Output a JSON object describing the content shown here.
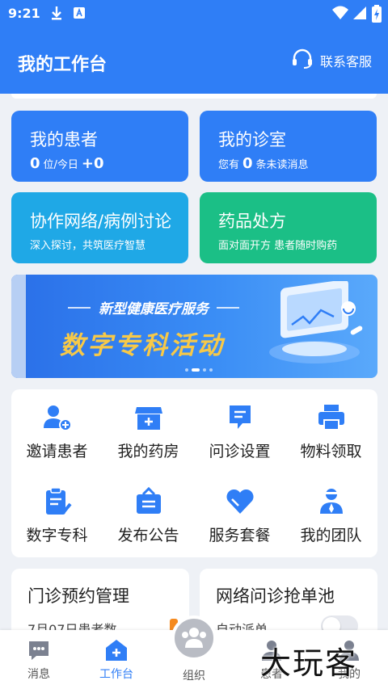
{
  "status": {
    "time": "9:21"
  },
  "header": {
    "title": "我的工作台",
    "service_label": "联系客服"
  },
  "cards": {
    "patients": {
      "title": "我的患者",
      "count": "0",
      "unit": "位/今日",
      "today": "+0"
    },
    "clinic": {
      "title": "我的诊室",
      "prefix": "您有",
      "count": "0",
      "suffix": "条未读消息"
    },
    "network": {
      "title": "协作网络/病例讨论",
      "sub": "深入探讨，共筑医疗智慧"
    },
    "drugs": {
      "title": "药品处方",
      "sub": "面对面开方 患者随时购药"
    }
  },
  "banner": {
    "subtitle": "新型健康医疗服务",
    "title": "数字专科活动"
  },
  "grid": [
    {
      "label": "邀请患者",
      "icon": "invite-patient-icon"
    },
    {
      "label": "我的药房",
      "icon": "pharmacy-icon"
    },
    {
      "label": "问诊设置",
      "icon": "consult-settings-icon"
    },
    {
      "label": "物料领取",
      "icon": "printer-icon"
    },
    {
      "label": "数字专科",
      "icon": "digital-specialty-icon"
    },
    {
      "label": "发布公告",
      "icon": "announcement-icon"
    },
    {
      "label": "服务套餐",
      "icon": "heart-icon"
    },
    {
      "label": "我的团队",
      "icon": "team-icon"
    }
  ],
  "bottom_cards": {
    "appointment": {
      "title": "门诊预约管理",
      "sub": "7月07日患者数"
    },
    "grab": {
      "title": "网络问诊抢单池",
      "sub": "自动派单"
    }
  },
  "tabs": [
    {
      "label": "消息"
    },
    {
      "label": "工作台"
    },
    {
      "label": "组织"
    },
    {
      "label": "患者"
    },
    {
      "label": "我的"
    }
  ],
  "watermark": "大玩客",
  "colors": {
    "primary": "#2f7ef6",
    "card_blue": "#2f7ef6",
    "card_cyan": "#1fa8e6",
    "card_green": "#1bbf86",
    "banner_gold": "#f7c948"
  }
}
